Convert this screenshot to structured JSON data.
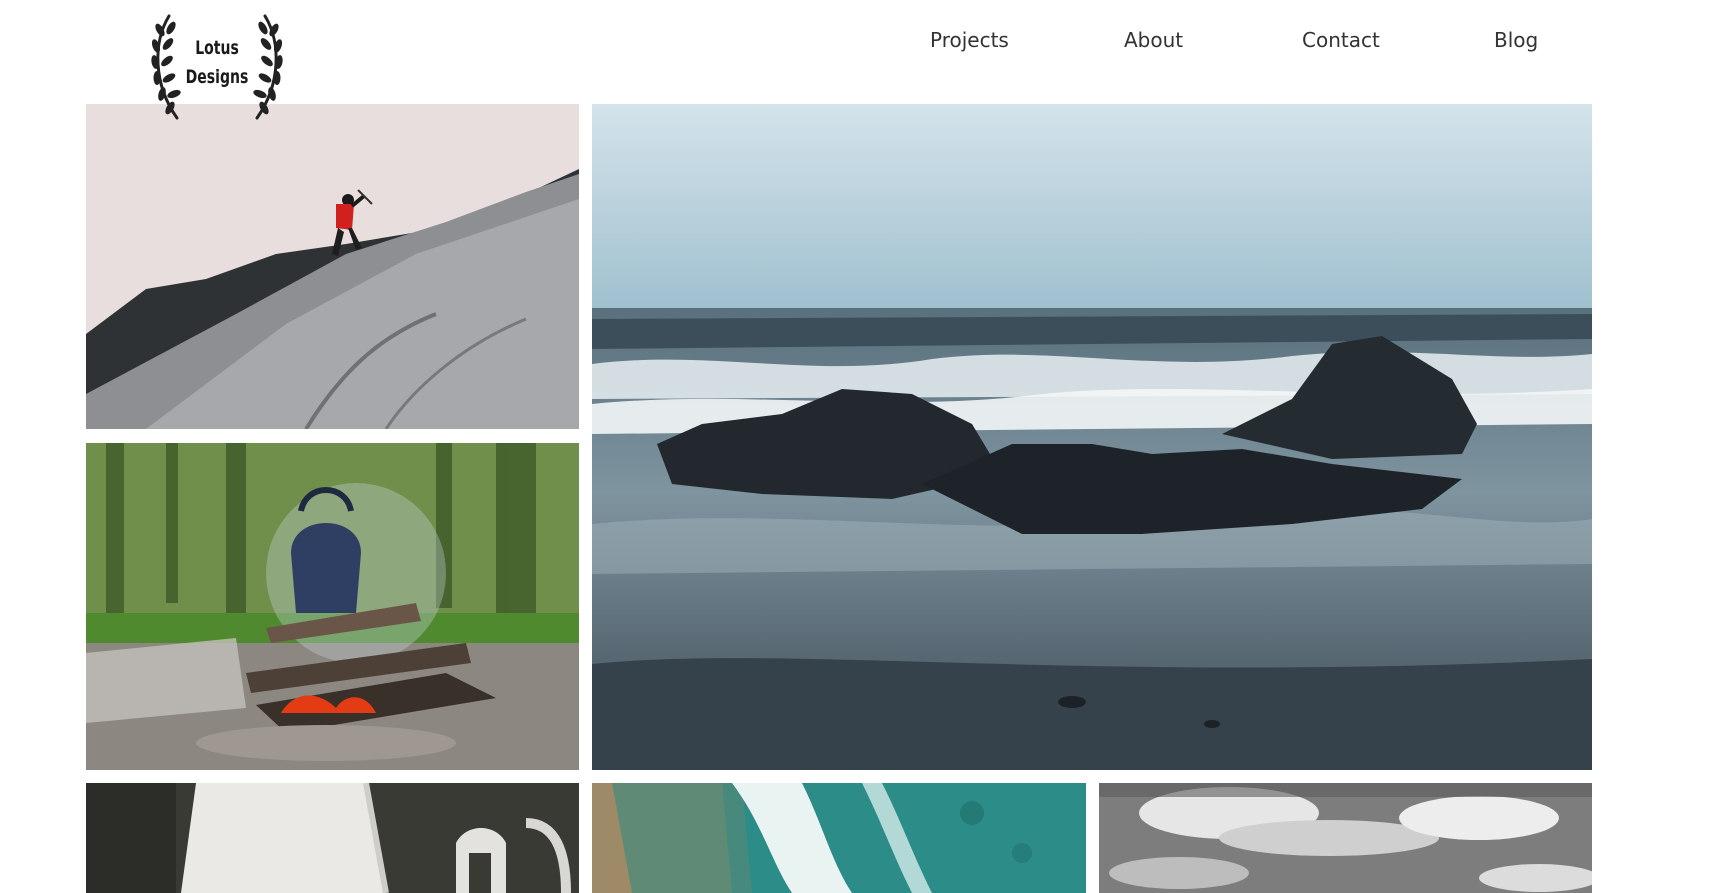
{
  "brand": {
    "line1": "Lotus",
    "line2": "Designs",
    "logo_icon": "laurel-wreath-icon"
  },
  "nav": {
    "items": [
      {
        "label": "Projects"
      },
      {
        "label": "About"
      },
      {
        "label": "Contact"
      },
      {
        "label": "Blog"
      }
    ]
  },
  "gallery": {
    "photos": [
      {
        "subject": "climber-on-rock"
      },
      {
        "subject": "stormy-sea-rocks"
      },
      {
        "subject": "campfire-kettle"
      },
      {
        "subject": "white-object-closeup"
      },
      {
        "subject": "aerial-ocean-waves"
      },
      {
        "subject": "grayscale-clouds"
      }
    ]
  }
}
